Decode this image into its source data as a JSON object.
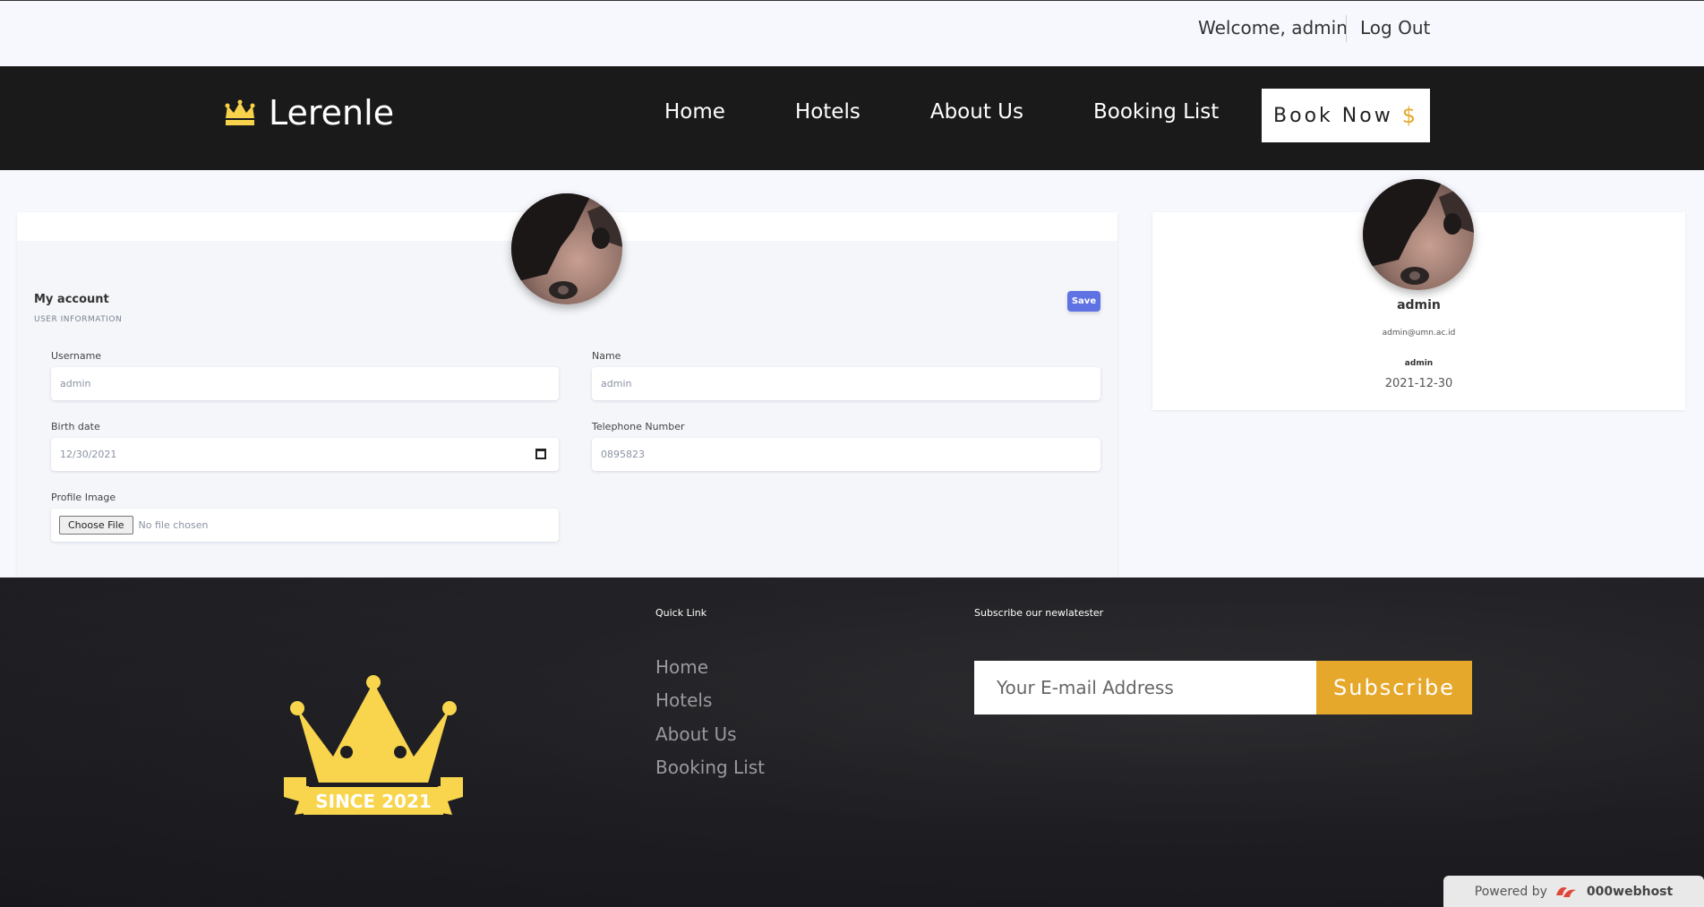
{
  "topbar": {
    "welcome": "Welcome, admin",
    "logout": "Log Out"
  },
  "nav": {
    "brand": "Lerenle",
    "links": [
      "Home",
      "Hotels",
      "About Us",
      "Booking List"
    ],
    "book_now": "Book Now",
    "book_now_icon": "$"
  },
  "account": {
    "title": "My account",
    "section": "USER INFORMATION",
    "save": "Save",
    "fields": {
      "username": {
        "label": "Username",
        "value": "admin"
      },
      "name": {
        "label": "Name",
        "value": "admin"
      },
      "birth": {
        "label": "Birth date",
        "value": "12/30/2021"
      },
      "phone": {
        "label": "Telephone Number",
        "value": "0895823"
      },
      "image": {
        "label": "Profile Image",
        "button": "Choose File",
        "status": "No file chosen"
      }
    }
  },
  "profile_card": {
    "name": "admin",
    "email": "admin@umn.ac.id",
    "role": "admin",
    "date": "2021-12-30"
  },
  "footer": {
    "badge": "SINCE 2021",
    "quick_link_title": "Quick Link",
    "quick_links": [
      "Home",
      "Hotels",
      "About Us",
      "Booking List"
    ],
    "subscribe_title": "Subscribe our newlatester",
    "email_placeholder": "Your E-mail Address",
    "subscribe": "Subscribe",
    "powered_by": "Powered by",
    "host": "000webhost"
  },
  "colors": {
    "accent": "#e6a82b",
    "save_button": "#5e72e4",
    "navbar": "#1a1a1a"
  }
}
